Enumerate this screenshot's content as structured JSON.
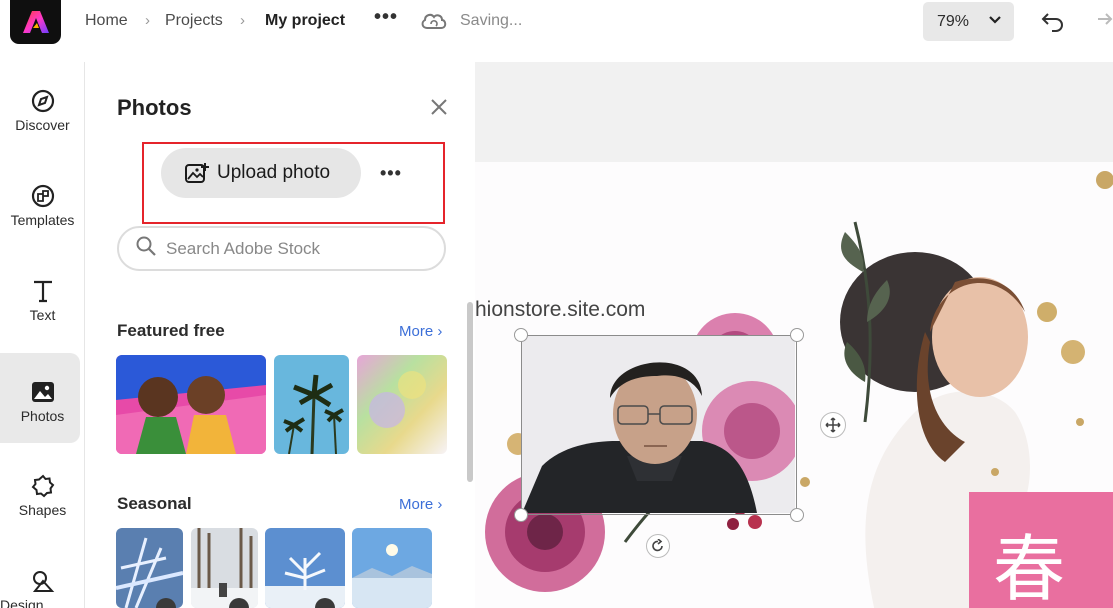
{
  "header": {
    "breadcrumbs": [
      "Home",
      "Projects",
      "My project"
    ],
    "status": "Saving...",
    "zoom": "79%"
  },
  "rail": {
    "items": [
      {
        "label": "Discover",
        "icon": "compass-icon"
      },
      {
        "label": "Templates",
        "icon": "templates-icon"
      },
      {
        "label": "Text",
        "icon": "text-icon"
      },
      {
        "label": "Photos",
        "icon": "photo-icon",
        "active": true
      },
      {
        "label": "Shapes",
        "icon": "shapes-icon"
      },
      {
        "label": "Design assets",
        "icon": "design-assets-icon"
      }
    ]
  },
  "panel": {
    "title": "Photos",
    "upload_label": "Upload photo",
    "search_placeholder": "Search Adobe Stock",
    "sections": [
      {
        "title": "Featured free",
        "more": "More"
      },
      {
        "title": "Seasonal",
        "more": "More"
      }
    ]
  },
  "canvas": {
    "site_text": "hionstore.site.com",
    "spring_char": "春"
  },
  "colors": {
    "accent_link": "#3c6fd8",
    "highlight_border": "#e5242b",
    "spring_pink": "#e96f9f"
  }
}
